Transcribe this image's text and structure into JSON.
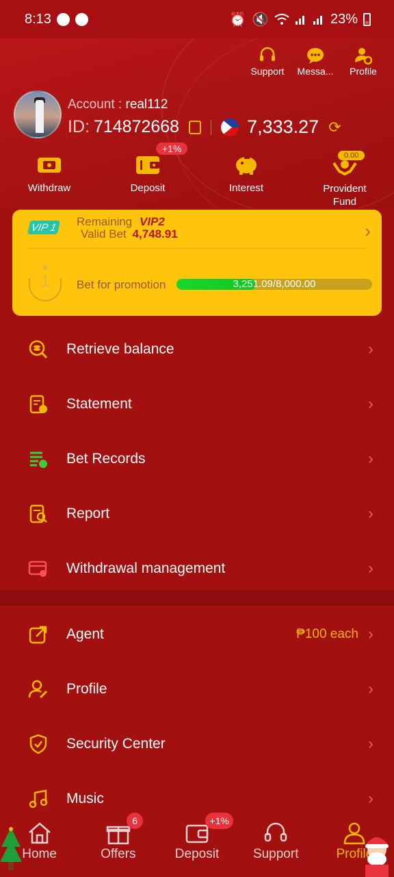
{
  "status_bar": {
    "time": "8:13",
    "battery": "23%"
  },
  "header": {
    "actions": [
      {
        "label": "Support",
        "icon": "headset-icon"
      },
      {
        "label": "Messa...",
        "icon": "message-icon"
      },
      {
        "label": "Profile",
        "icon": "profile-gear-icon"
      }
    ],
    "account_label": "Account :",
    "account_value": "real112",
    "id_label": "ID:",
    "id_value": "714872668",
    "balance": "7,333.27"
  },
  "quick_actions": [
    {
      "label": "Withdraw",
      "icon": "withdraw-icon"
    },
    {
      "label": "Deposit",
      "icon": "wallet-icon",
      "badge": "+1%"
    },
    {
      "label": "Interest",
      "icon": "piggy-bank-icon"
    },
    {
      "label": "Provident Fund",
      "icon": "hands-coin-icon",
      "badge": "0.00"
    }
  ],
  "vip": {
    "current": "VIP 1",
    "remaining_label": "Remaining",
    "next_level": "VIP2",
    "valid_bet_label": "Valid Bet",
    "valid_bet_value": "4,748.91",
    "rank": "1",
    "promo_label": "Bet for promotion",
    "progress_text": "3,251.09/8,000.00",
    "progress_fraction": 0.406
  },
  "menu_group_1": [
    {
      "label": "Retrieve balance",
      "icon": "retrieve-balance-icon"
    },
    {
      "label": "Statement",
      "icon": "statement-icon"
    },
    {
      "label": "Bet Records",
      "icon": "bet-records-icon"
    },
    {
      "label": "Report",
      "icon": "report-icon"
    },
    {
      "label": "Withdrawal management",
      "icon": "withdrawal-management-icon"
    }
  ],
  "menu_group_2": [
    {
      "label": "Agent",
      "icon": "share-icon",
      "extra": "₱100 each"
    },
    {
      "label": "Profile",
      "icon": "user-edit-icon"
    },
    {
      "label": "Security Center",
      "icon": "shield-check-icon"
    },
    {
      "label": "Music",
      "icon": "music-icon"
    }
  ],
  "tabbar": [
    {
      "label": "Home",
      "icon": "home-icon"
    },
    {
      "label": "Offers",
      "icon": "gift-icon",
      "badge": "6"
    },
    {
      "label": "Deposit",
      "icon": "wallet-tab-icon",
      "badge": "+1%"
    },
    {
      "label": "Support",
      "icon": "headset-tab-icon"
    },
    {
      "label": "Profile",
      "icon": "person-tab-icon"
    }
  ],
  "colors": {
    "background": "#a31010",
    "accent": "#f5b800",
    "vip_card": "#ffc50c",
    "progress": "#1bd62b",
    "badge": "#e8323c"
  }
}
